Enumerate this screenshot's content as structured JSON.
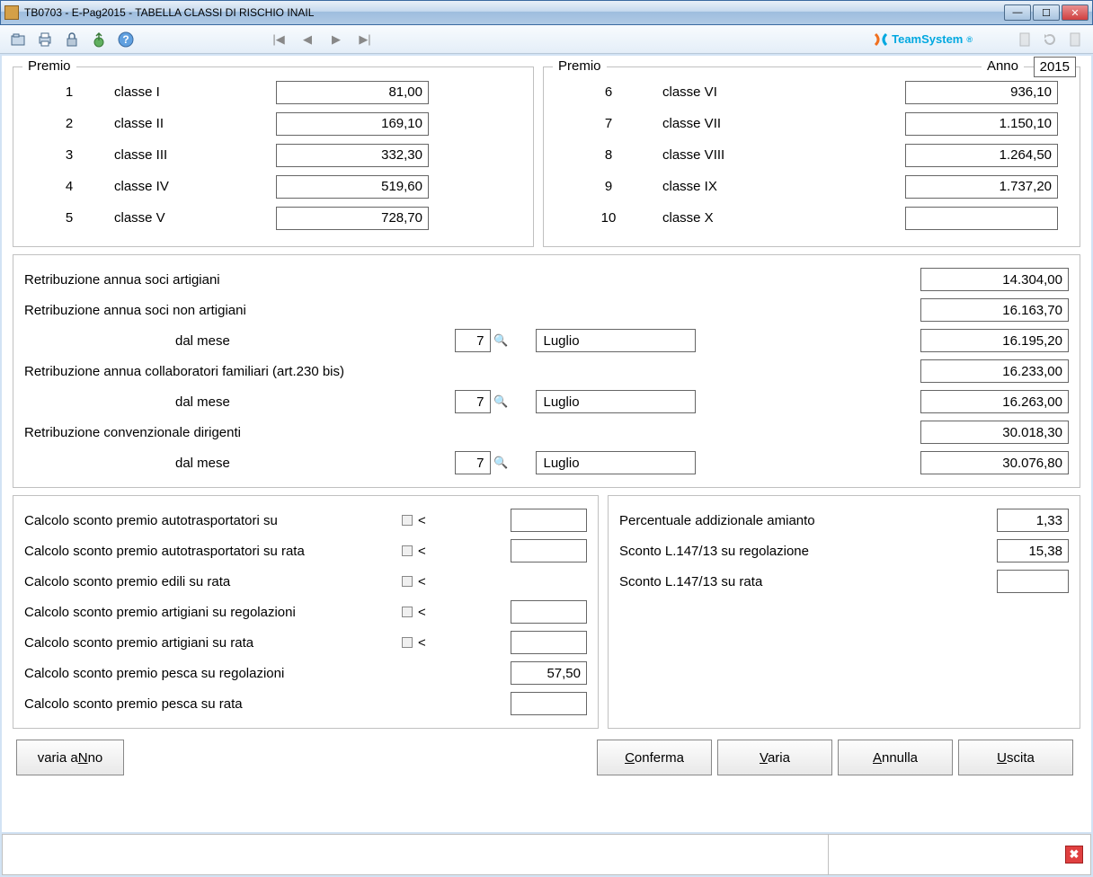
{
  "window": {
    "title": "TB0703  -  E-Pag2015  -  TABELLA CLASSI DI RISCHIO INAIL"
  },
  "brand": "TeamSystem",
  "premio": {
    "legend": "Premio",
    "anno_label": "Anno",
    "anno_value": "2015",
    "left": [
      {
        "num": "1",
        "label": "classe I",
        "value": "81,00"
      },
      {
        "num": "2",
        "label": "classe II",
        "value": "169,10"
      },
      {
        "num": "3",
        "label": "classe III",
        "value": "332,30"
      },
      {
        "num": "4",
        "label": "classe IV",
        "value": "519,60"
      },
      {
        "num": "5",
        "label": "classe V",
        "value": "728,70"
      }
    ],
    "right": [
      {
        "num": "6",
        "label": "classe VI",
        "value": "936,10"
      },
      {
        "num": "7",
        "label": "classe VII",
        "value": "1.150,10"
      },
      {
        "num": "8",
        "label": "classe VIII",
        "value": "1.264,50"
      },
      {
        "num": "9",
        "label": "classe IX",
        "value": "1.737,20"
      },
      {
        "num": "10",
        "label": "classe X",
        "value": ""
      }
    ]
  },
  "retrib": {
    "rows": [
      {
        "label": "Retribuzione annua soci artigiani",
        "value": "14.304,00"
      },
      {
        "label": "Retribuzione annua soci non artigiani",
        "value": "16.163,70"
      },
      {
        "label": "dal mese",
        "indent": true,
        "month_num": "7",
        "month_name": "Luglio",
        "value": "16.195,20"
      },
      {
        "label": "Retribuzione annua collaboratori familiari (art.230 bis)",
        "value": "16.233,00"
      },
      {
        "label": "dal mese",
        "indent": true,
        "month_num": "7",
        "month_name": "Luglio",
        "value": "16.263,00"
      },
      {
        "label": "Retribuzione convenzionale dirigenti",
        "value": "30.018,30"
      },
      {
        "label": "dal mese",
        "indent": true,
        "month_num": "7",
        "month_name": "Luglio",
        "value": "30.076,80"
      }
    ]
  },
  "sconti_left": [
    {
      "label": "Calcolo sconto premio autotrasportatori su",
      "check": true,
      "value": ""
    },
    {
      "label": "Calcolo sconto premio autotrasportatori su rata",
      "check": true,
      "value": ""
    },
    {
      "label": "Calcolo sconto premio edili su rata",
      "check": true,
      "value": null
    },
    {
      "label": "Calcolo sconto premio artigiani su regolazioni",
      "check": true,
      "value": ""
    },
    {
      "label": "Calcolo sconto premio artigiani su rata",
      "check": true,
      "value": ""
    },
    {
      "label": "Calcolo sconto premio pesca su regolazioni",
      "check": false,
      "value": "57,50"
    },
    {
      "label": "Calcolo sconto premio pesca su rata",
      "check": false,
      "value": ""
    }
  ],
  "sconti_right": [
    {
      "label": "Percentuale addizionale amianto",
      "value": "1,33"
    },
    {
      "label": "Sconto L.147/13 su regolazione",
      "value": "15,38"
    },
    {
      "label": "Sconto L.147/13 su rata",
      "value": ""
    }
  ],
  "buttons": {
    "varia_anno": "varia aNno",
    "conferma": "Conferma",
    "varia": "Varia",
    "annulla": "Annulla",
    "uscita": "Uscita"
  },
  "lt_symbol": "<"
}
